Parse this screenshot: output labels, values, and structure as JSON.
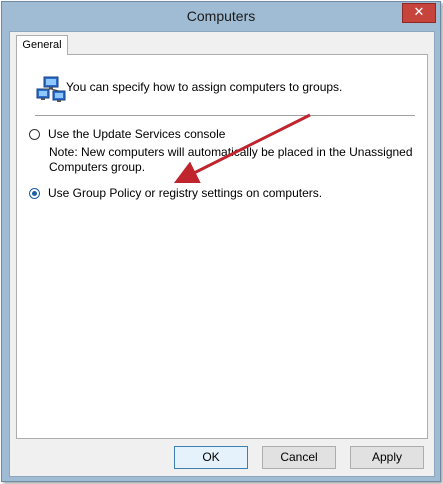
{
  "window": {
    "title": "Computers",
    "close_glyph": "✕"
  },
  "tabs": [
    {
      "label": "General"
    }
  ],
  "general": {
    "intro_text": "You can specify how to assign computers to groups.",
    "intro_icon": "computers-icon",
    "options": [
      {
        "label": "Use the Update Services console",
        "selected": false
      },
      {
        "label": "Use Group Policy or registry settings on computers.",
        "selected": true
      }
    ],
    "note_line1": "Note: New computers will automatically be placed in the Unassigned",
    "note_line2": "Computers group."
  },
  "buttons": {
    "ok": "OK",
    "cancel": "Cancel",
    "apply": "Apply"
  },
  "colors": {
    "title_bar": "#a0bcd4",
    "close_button": "#c7443c",
    "annotation_arrow": "#c0242c",
    "radio_selected": "#1b5fa6"
  }
}
